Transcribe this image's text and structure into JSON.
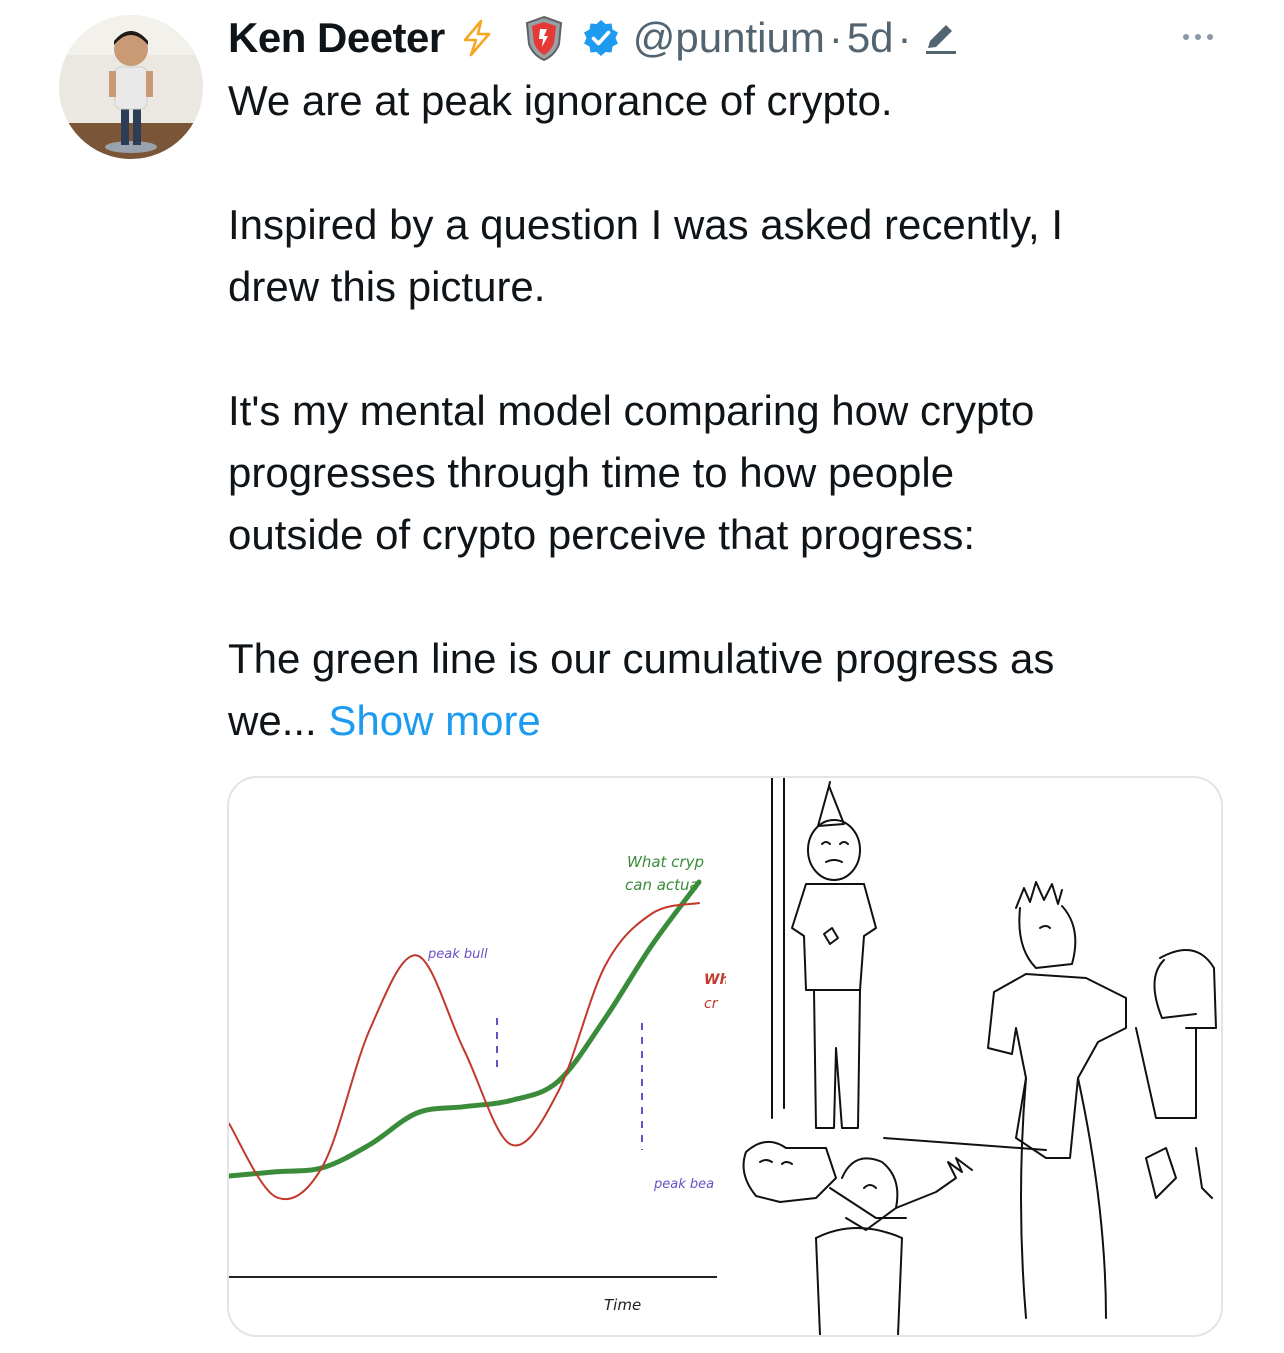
{
  "tweet": {
    "author_name": "Ken Deeter",
    "handle": "@puntium",
    "separator": "·",
    "timestamp": "5d",
    "lines": [
      "We are at peak ignorance of crypto.",
      "Inspired by a question I was asked recently, I",
      "drew this picture.",
      "It's my mental model comparing how crypto",
      "progresses through time to how people",
      "outside of crypto perceive that progress:",
      "The green line is our cumulative progress as",
      "we..."
    ],
    "show_more_label": "Show more",
    "icons": [
      "avatar",
      "lightning-icon",
      "shield-badge-icon",
      "verified-badge-icon",
      "edit-pencil-icon",
      "more-options-icon"
    ],
    "colors": {
      "link": "#1d9bf0",
      "muted": "#536471",
      "verified": "#1d9bf0",
      "lightning": "#f5a623"
    }
  },
  "media": {
    "chart": {
      "labels": {
        "what_crypto_top": "What cryp",
        "what_crypto_bottom": "can actua",
        "red_label_top": "Wh",
        "red_label_bottom": "cr",
        "peak_bull": "peak bull",
        "peak_bear": "peak bea",
        "x_axis": "Time"
      }
    },
    "meme": {
      "description_icon": "party-wojak-drawing"
    }
  },
  "chart_data": {
    "type": "line",
    "title": "",
    "xlabel": "Time",
    "ylabel": "",
    "x": [
      0,
      1,
      2,
      3,
      4,
      5,
      6,
      7,
      8,
      9,
      10
    ],
    "series": [
      {
        "values": [
          2.0,
          2.2,
          2.4,
          3.5,
          5.0,
          5.3,
          5.6,
          6.5,
          9.5,
          13.0,
          16.0
        ],
        "color": "#3a8c3a"
      },
      {
        "values": [
          4.5,
          1.0,
          2.5,
          9.0,
          12.5,
          8.0,
          3.5,
          6.0,
          12.0,
          14.5,
          15.0
        ],
        "color": "#c0392b"
      }
    ],
    "annotations": [
      "What cryp",
      "can actua",
      "peak bull",
      "peak bea",
      "Wh",
      "cr"
    ],
    "grid": false
  }
}
